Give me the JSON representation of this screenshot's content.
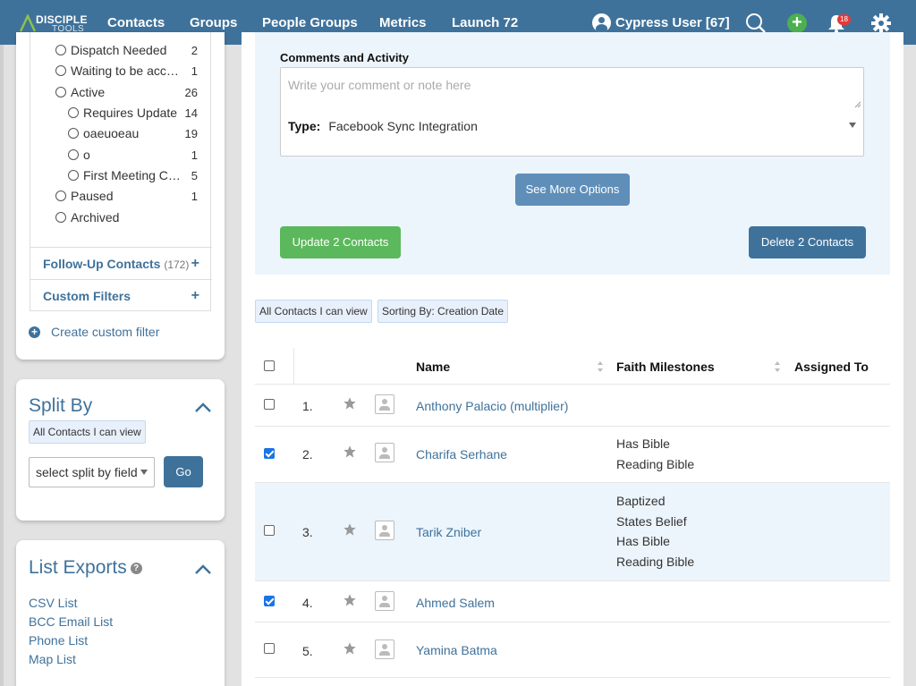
{
  "app": {
    "logo_top": "DISCIPLE",
    "logo_bottom": "TOOLS"
  },
  "nav": {
    "items": [
      "Contacts",
      "Groups",
      "People Groups",
      "Metrics",
      "Launch 72"
    ],
    "user": "Cypress User [67]",
    "notifications": "18"
  },
  "filters": {
    "items": [
      {
        "label": "Dispatch Needed",
        "count": "2",
        "level": 1
      },
      {
        "label": "Waiting to be accep…",
        "count": "1",
        "level": 1
      },
      {
        "label": "Active",
        "count": "26",
        "level": 1
      },
      {
        "label": "Requires Update",
        "count": "14",
        "level": 2
      },
      {
        "label": "oaeuoeau",
        "count": "19",
        "level": 2
      },
      {
        "label": "o",
        "count": "1",
        "level": 2
      },
      {
        "label": "First Meeting Co…",
        "count": "5",
        "level": 2
      },
      {
        "label": "Paused",
        "count": "1",
        "level": 1
      },
      {
        "label": "Archived",
        "count": "",
        "level": 1
      }
    ],
    "follow_up": {
      "label": "Follow-Up Contacts",
      "count": "(172)"
    },
    "custom": {
      "label": "Custom Filters"
    },
    "create": "Create custom filter"
  },
  "split": {
    "title": "Split By",
    "chip": "All Contacts I can view",
    "select": "select split by field",
    "go": "Go"
  },
  "exports": {
    "title": "List Exports",
    "links": [
      "CSV List",
      "BCC Email List",
      "Phone List",
      "Map List"
    ]
  },
  "bulk": {
    "comments_label": "Comments and Activity",
    "comment_placeholder": "Write your comment or note here",
    "type_label": "Type:",
    "type_value": "Facebook Sync Integration",
    "more_options": "See More Options",
    "update": "Update 2 Contacts",
    "delete": "Delete 2 Contacts"
  },
  "list": {
    "chips": [
      "All Contacts I can view",
      "Sorting By: Creation Date"
    ],
    "headers": {
      "name": "Name",
      "milestones": "Faith Milestones",
      "assigned": "Assigned To"
    },
    "rows": [
      {
        "num": "1.",
        "name": "Anthony Palacio (multiplier)",
        "checked": false,
        "milestones": []
      },
      {
        "num": "2.",
        "name": "Charifa Serhane",
        "checked": true,
        "milestones": [
          "Has Bible",
          "Reading Bible"
        ]
      },
      {
        "num": "3.",
        "name": "Tarik Zniber",
        "checked": false,
        "milestones": [
          "Baptized",
          "States Belief",
          "Has Bible",
          "Reading Bible"
        ]
      },
      {
        "num": "4.",
        "name": "Ahmed Salem",
        "checked": true,
        "milestones": []
      },
      {
        "num": "5.",
        "name": "Yamina Batma",
        "checked": false,
        "milestones": []
      }
    ]
  },
  "colors": {
    "brand": "#3f729b",
    "success": "#5cb85c",
    "highlight": "#ecf5fc"
  }
}
